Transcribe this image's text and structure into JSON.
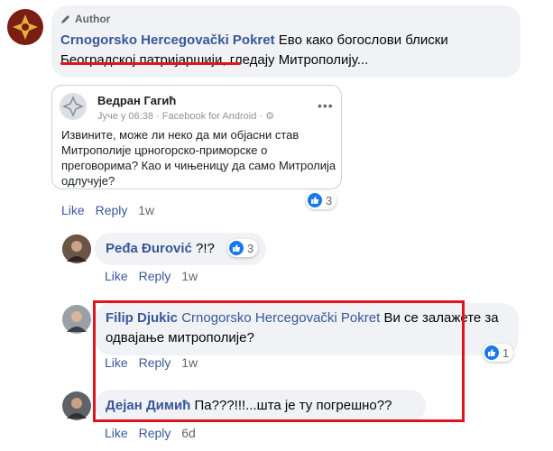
{
  "main_comment": {
    "badge": "Author",
    "author": "Crnogorsko Hercegovački Pokret",
    "text": " Ево како богослови блиски Београдској патријаршији, гледају Митрополију..."
  },
  "attached_post": {
    "author": "Ведран Гагић",
    "meta": "Јуче у 06:38 · Facebook for Android · ",
    "body": "Извините, може ли неко да ми објасни став Митрополије црногорско-приморске о преговорима? Као и чињеницу да само Митролија одлучује?",
    "reactions": "3"
  },
  "main_actions": {
    "like": "Like",
    "reply": "Reply",
    "time": "1w"
  },
  "replies": [
    {
      "author": "Peđa Đurović",
      "text": " ?!?",
      "reactions": "3",
      "like": "Like",
      "reply": "Reply",
      "time": "1w"
    },
    {
      "author": "Filip Djukic",
      "mention": "Crnogorsko Hercegovački Pokret",
      "text": " Ви се залажете за одвајање митрополије?",
      "reactions": "1",
      "like": "Like",
      "reply": "Reply",
      "time": "1w"
    },
    {
      "author": "Дејан Димић",
      "text": " Па???!!!...шта је ту погрешно??",
      "like": "Like",
      "reply": "Reply",
      "time": "6d"
    }
  ]
}
